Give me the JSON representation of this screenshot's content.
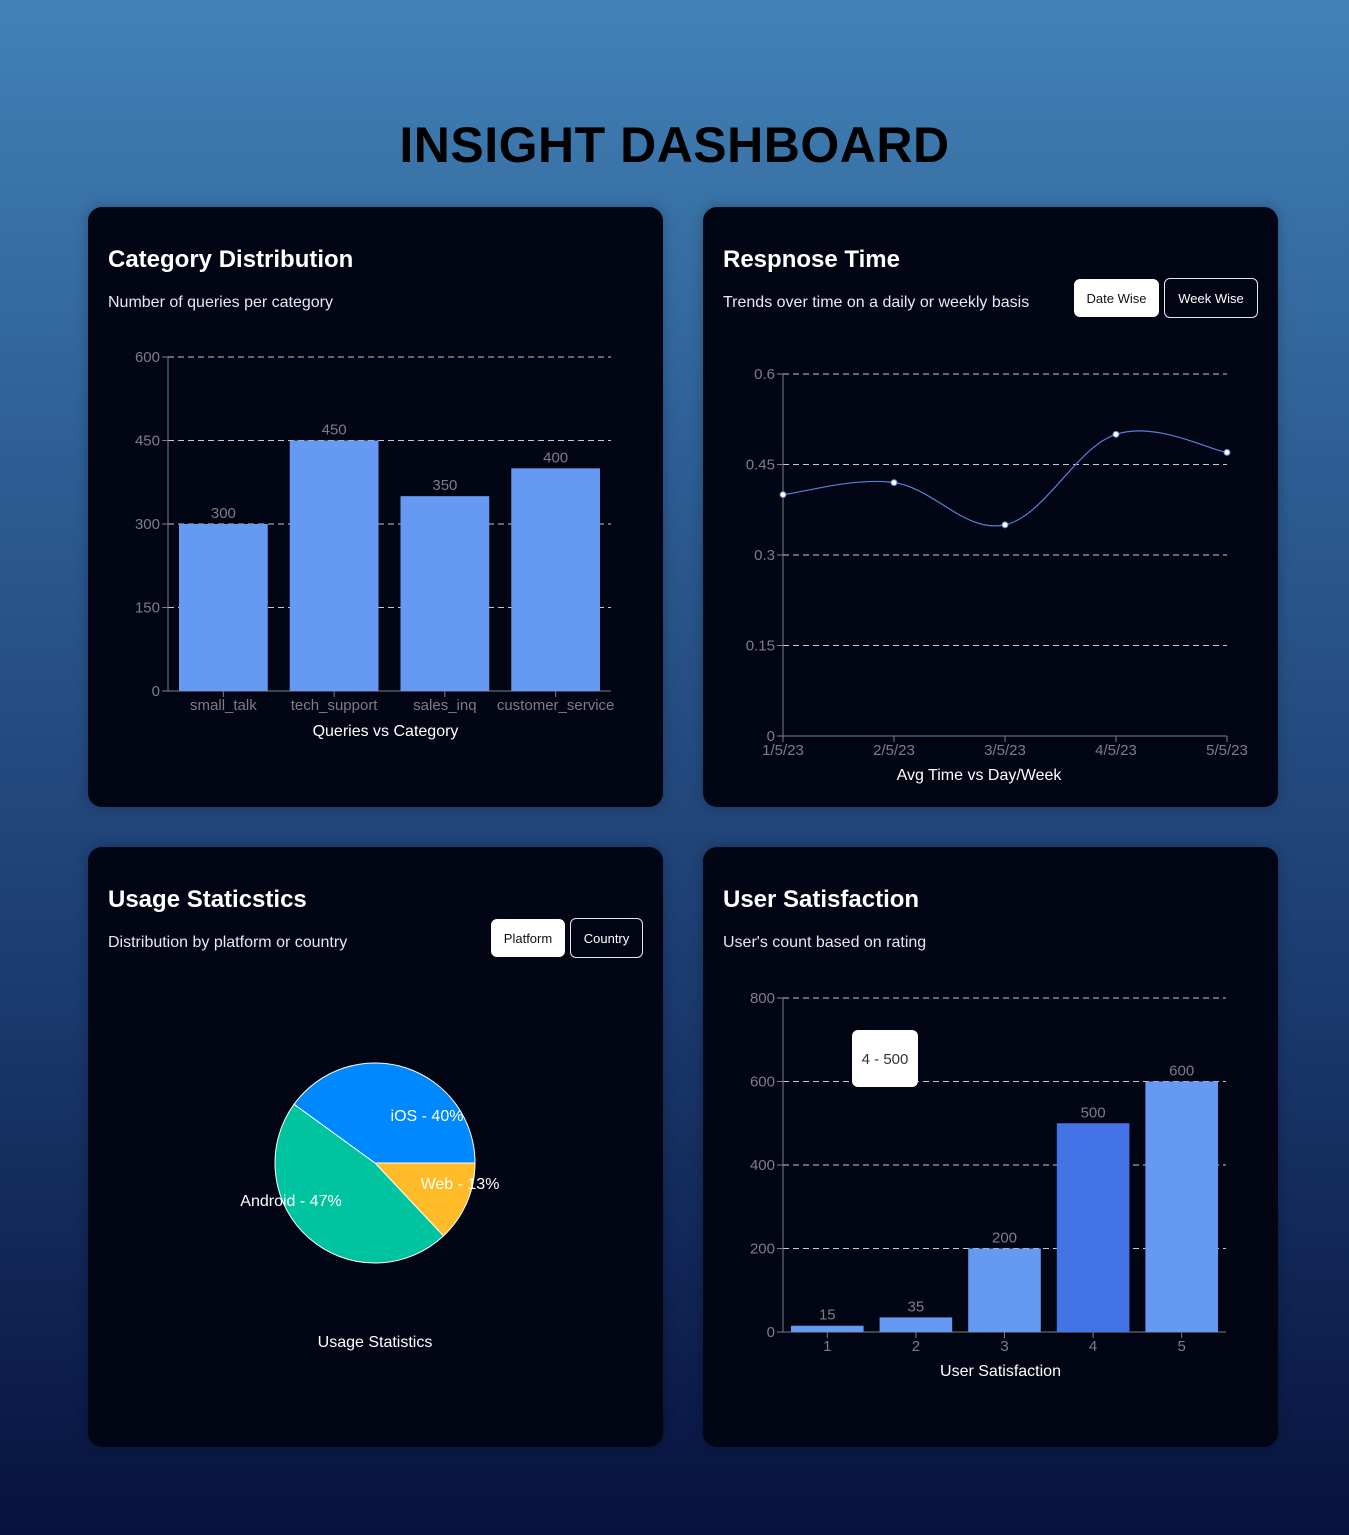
{
  "page": {
    "title": "INSIGHT DASHBOARD"
  },
  "cards": {
    "category": {
      "title": "Category Distribution",
      "subtitle": "Number of queries per category"
    },
    "response": {
      "title": "Respnose Time",
      "subtitle": "Trends over time on a daily or weekly basis",
      "buttons": {
        "date_wise": "Date Wise",
        "week_wise": "Week Wise"
      },
      "active_button": "Date Wise"
    },
    "usage": {
      "title": "Usage Staticstics",
      "subtitle": "Distribution by platform or country",
      "buttons": {
        "platform": "Platform",
        "country": "Country"
      },
      "active_button": "Platform"
    },
    "satisfaction": {
      "title": "User Satisfaction",
      "subtitle": "User's count based on rating",
      "tooltip": "4 - 500"
    }
  },
  "colors": {
    "bar": "#6699f2",
    "bar_highlight": "#4473e6",
    "line": "#5b7fd6",
    "ios": "#0088fe",
    "android": "#00c49f",
    "web": "#ffbb28",
    "axis_text": "#7d7d84",
    "grid": "#c8c8c8"
  },
  "chart_data": [
    {
      "id": "category",
      "type": "bar",
      "categories": [
        "small_talk",
        "tech_support",
        "sales_inq",
        "customer_service"
      ],
      "values": [
        300,
        450,
        350,
        400
      ],
      "xlabel": "Queries vs Category",
      "ylim": [
        0,
        600
      ],
      "yticks": [
        0,
        150,
        300,
        450,
        600
      ],
      "grid": true
    },
    {
      "id": "response",
      "type": "line",
      "x": [
        "1/5/23",
        "2/5/23",
        "3/5/23",
        "4/5/23",
        "5/5/23"
      ],
      "values": [
        0.4,
        0.42,
        0.35,
        0.5,
        0.47
      ],
      "xlabel": "Avg Time vs Day/Week",
      "ylim": [
        0,
        0.6
      ],
      "yticks": [
        "0",
        "0.15",
        "0.3",
        "0.45",
        "0.6"
      ],
      "grid": true
    },
    {
      "id": "usage",
      "type": "pie",
      "slices": [
        {
          "label": "iOS - 40%",
          "value": 40,
          "colorKey": "ios"
        },
        {
          "label": "Web - 13%",
          "value": 13,
          "colorKey": "web"
        },
        {
          "label": "Android - 47%",
          "value": 47,
          "colorKey": "android"
        }
      ],
      "xlabel": "Usage Statistics"
    },
    {
      "id": "satisfaction",
      "type": "bar",
      "categories": [
        "1",
        "2",
        "3",
        "4",
        "5"
      ],
      "values": [
        15,
        35,
        200,
        500,
        600
      ],
      "highlight_index": 3,
      "xlabel": "User Satisfaction",
      "ylim": [
        0,
        800
      ],
      "yticks": [
        0,
        200,
        400,
        600,
        800
      ],
      "grid": true
    }
  ]
}
